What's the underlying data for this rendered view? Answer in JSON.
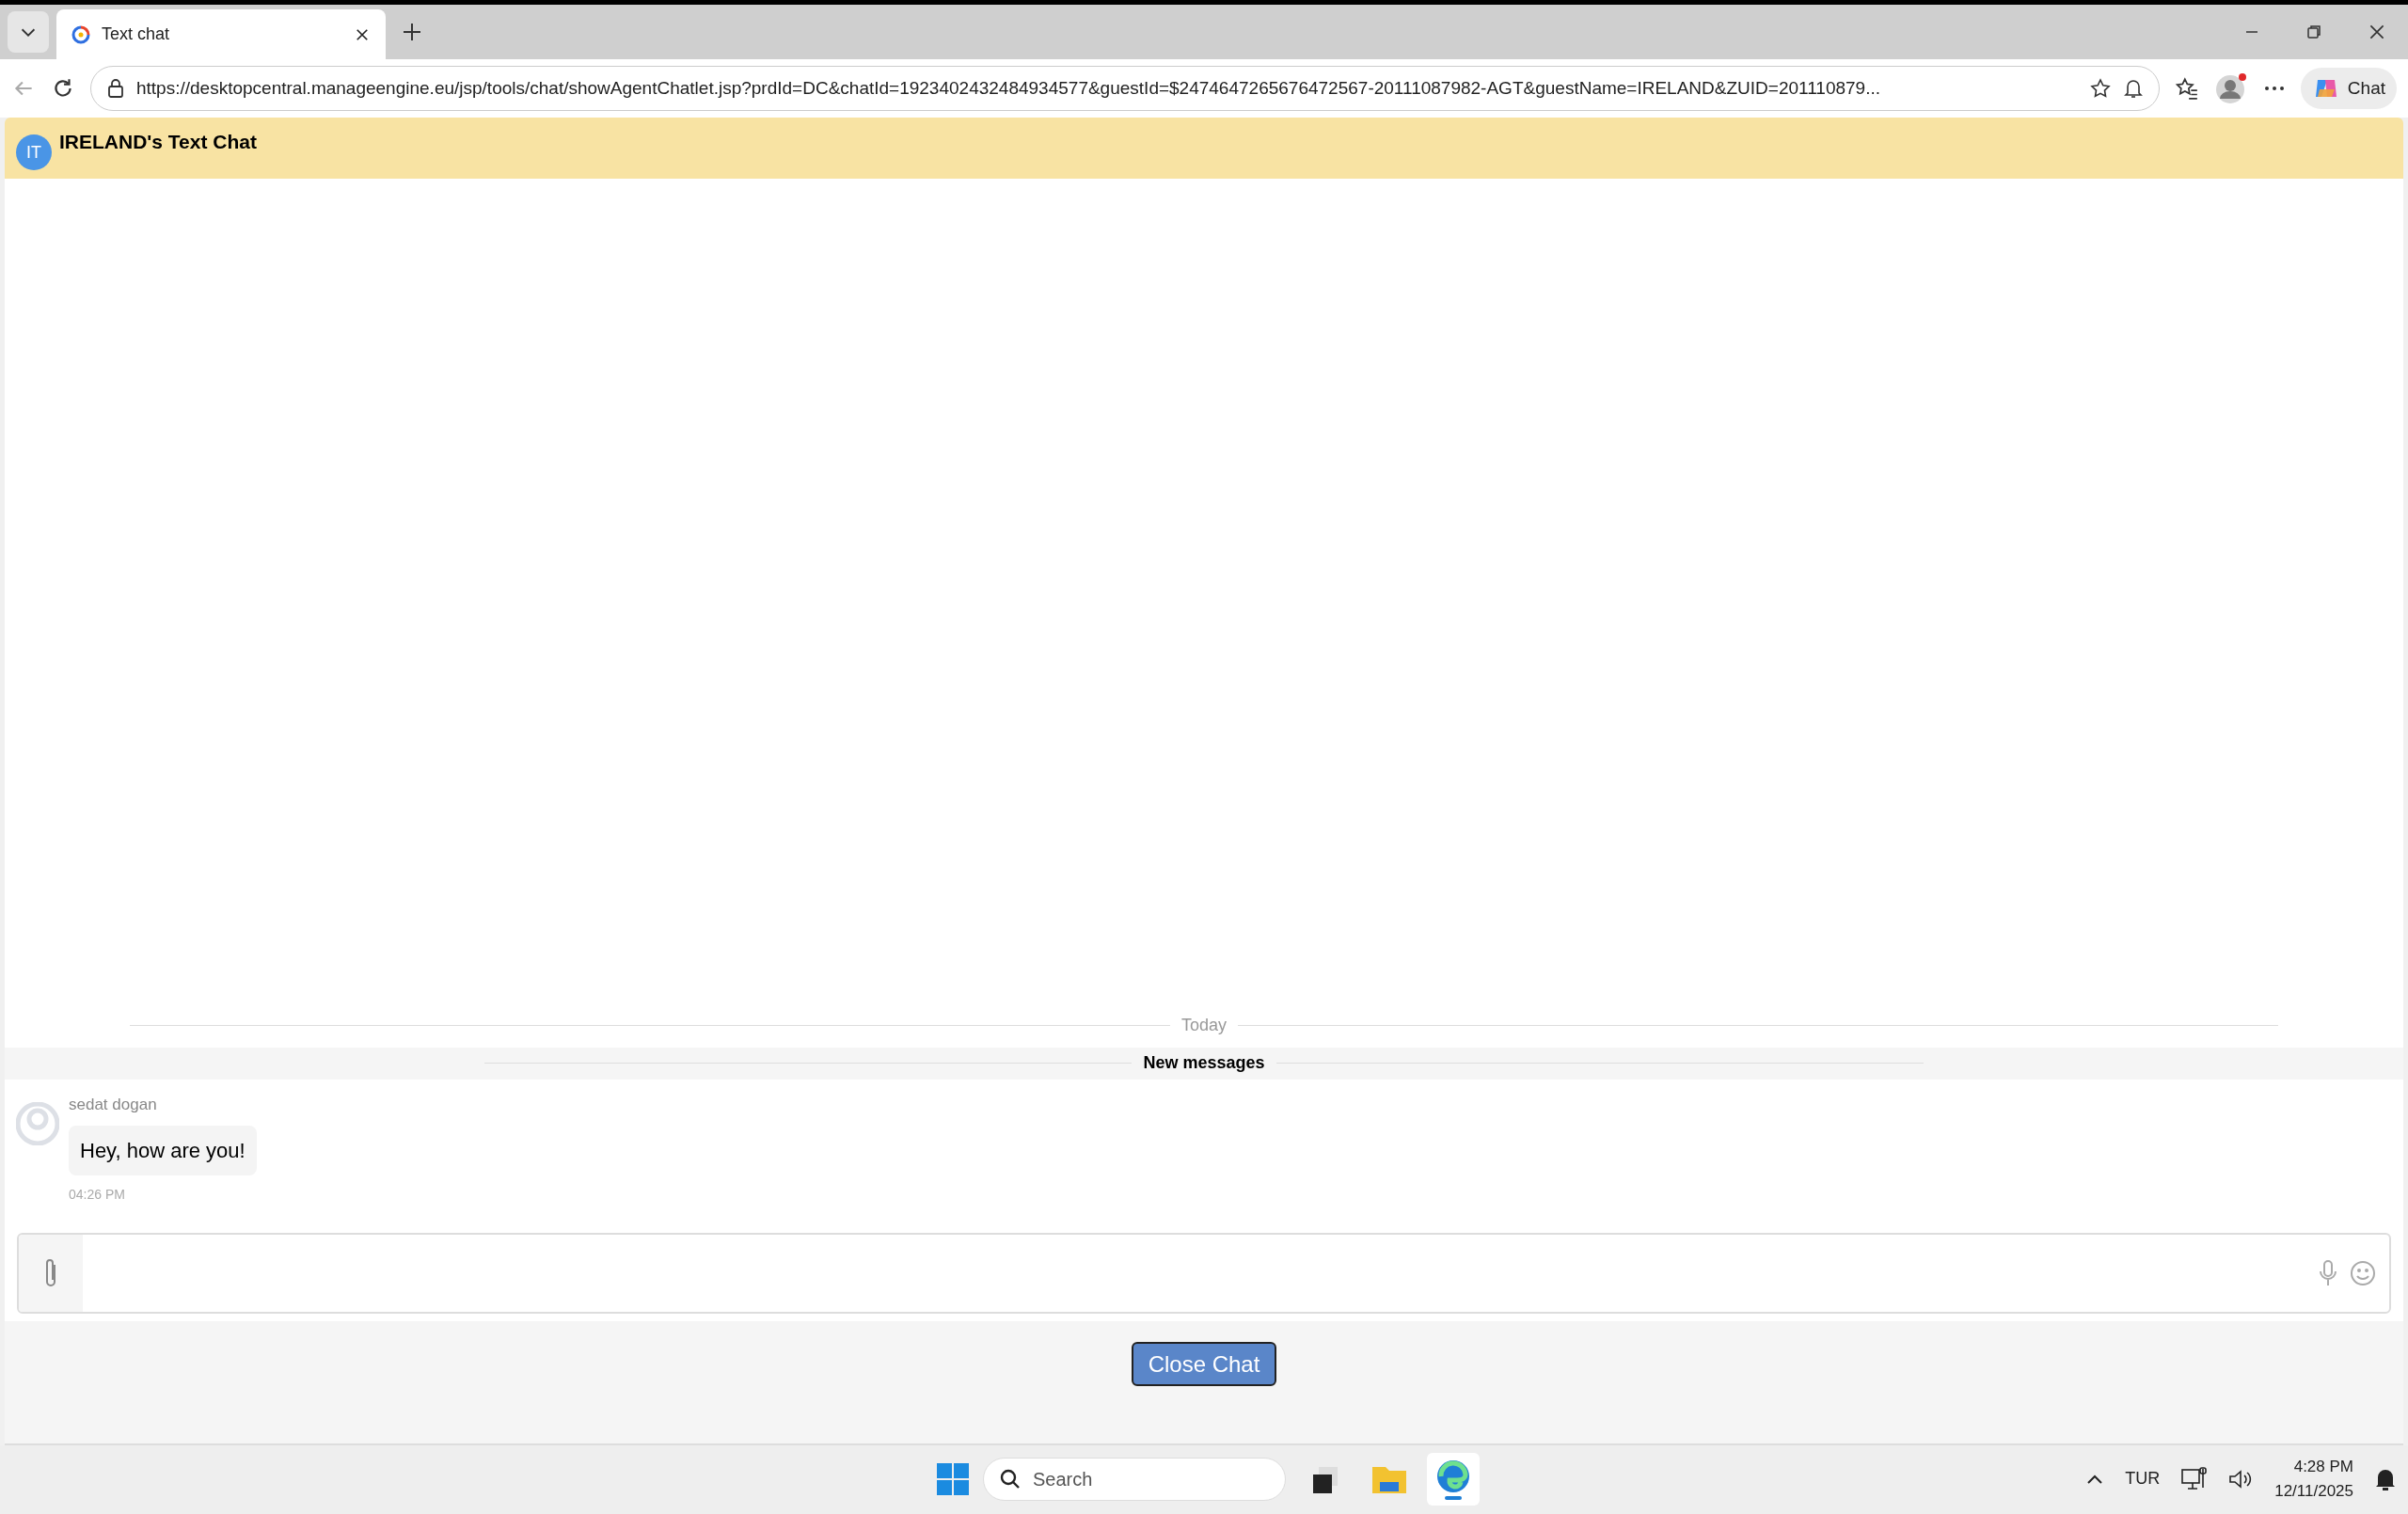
{
  "browser": {
    "tabs": [
      {
        "title": "Text chat",
        "selected": true
      }
    ],
    "address": "https://desktopcentral.manageengine.eu/jsp/tools/chat/showAgentChatlet.jsp?prdId=DC&chatId=1923402432484934577&guestId=$2474647265676472567-20111087982-AGT&guestName=IRELAND&ZUID=201110879...",
    "copilot_label": "Chat"
  },
  "chat": {
    "avatar": "IT",
    "title": "IRELAND's Text Chat",
    "date_divider": "Today",
    "new_messages": "New messages",
    "messages": [
      {
        "sender": "sedat dogan",
        "text": "Hey, how are you!",
        "time": "04:26 PM"
      }
    ],
    "close_button": "Close Chat"
  },
  "taskbar": {
    "search": {
      "placeholder": "Search"
    },
    "apps": [
      {
        "kind": "terminal",
        "active": false
      },
      {
        "kind": "folder",
        "active": false
      },
      {
        "kind": "browser",
        "active": true
      }
    ],
    "language": "TUR",
    "time": "4:28 PM",
    "date": "12/11/2025"
  }
}
